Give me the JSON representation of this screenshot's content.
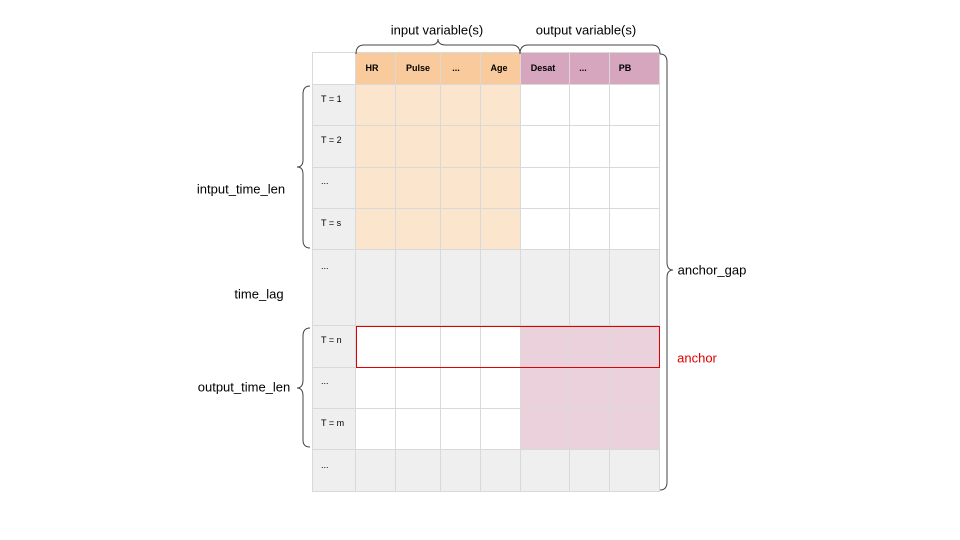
{
  "top_labels": {
    "input": "input variable(s)",
    "output": "output variable(s)"
  },
  "columns": [
    "HR",
    "Pulse",
    "...",
    "Age",
    "Desat",
    "...",
    "PB"
  ],
  "rows": [
    "T = 1",
    "T = 2",
    "...",
    "T = s",
    "...",
    "T = n",
    "...",
    "T = m",
    "..."
  ],
  "side_labels": {
    "input_time_len": "intput_time_len",
    "time_lag": "time_lag",
    "output_time_len": "output_time_len",
    "anchor_gap": "anchor_gap",
    "anchor": "anchor"
  },
  "colors": {
    "input_header": "#f9cb9c",
    "output_header": "#d5a6bd",
    "input_fill": "#fce5cd",
    "output_fill": "#ead1dc",
    "label_col": "#efefef",
    "lag_fill": "#efefef",
    "anchor_outline": "#e00000"
  }
}
